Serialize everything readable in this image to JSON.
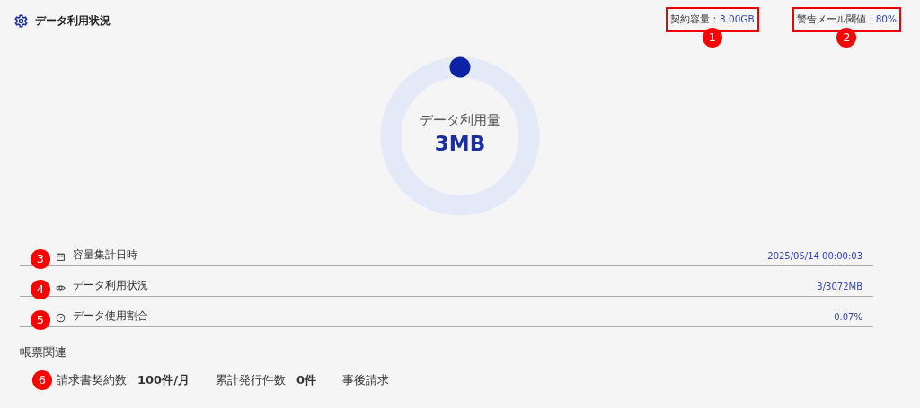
{
  "header": {
    "title": "データ利用状況"
  },
  "contract": {
    "label": "契約容量：",
    "value": "3.00GB",
    "marker": "1"
  },
  "threshold": {
    "label": "警告メール閾値：",
    "value": "80%",
    "marker": "2"
  },
  "usage": {
    "label": "データ利用量",
    "value": "3MB"
  },
  "rows": [
    {
      "marker": "3",
      "kind": "calendar",
      "label": "容量集計日時",
      "value": "2025/05/14 00:00:03"
    },
    {
      "marker": "4",
      "kind": "eye",
      "label": "データ利用状況",
      "value": "3/3072MB"
    },
    {
      "marker": "5",
      "kind": "gauge",
      "label": "データ使用割合",
      "value": "0.07%"
    }
  ],
  "forms": {
    "title": "帳票関連",
    "marker": "6",
    "items": [
      {
        "label": "請求書契約数",
        "value": "100件/月"
      },
      {
        "label": "累計発行件数",
        "value": "0件"
      },
      {
        "label": "事後請求"
      }
    ]
  }
}
